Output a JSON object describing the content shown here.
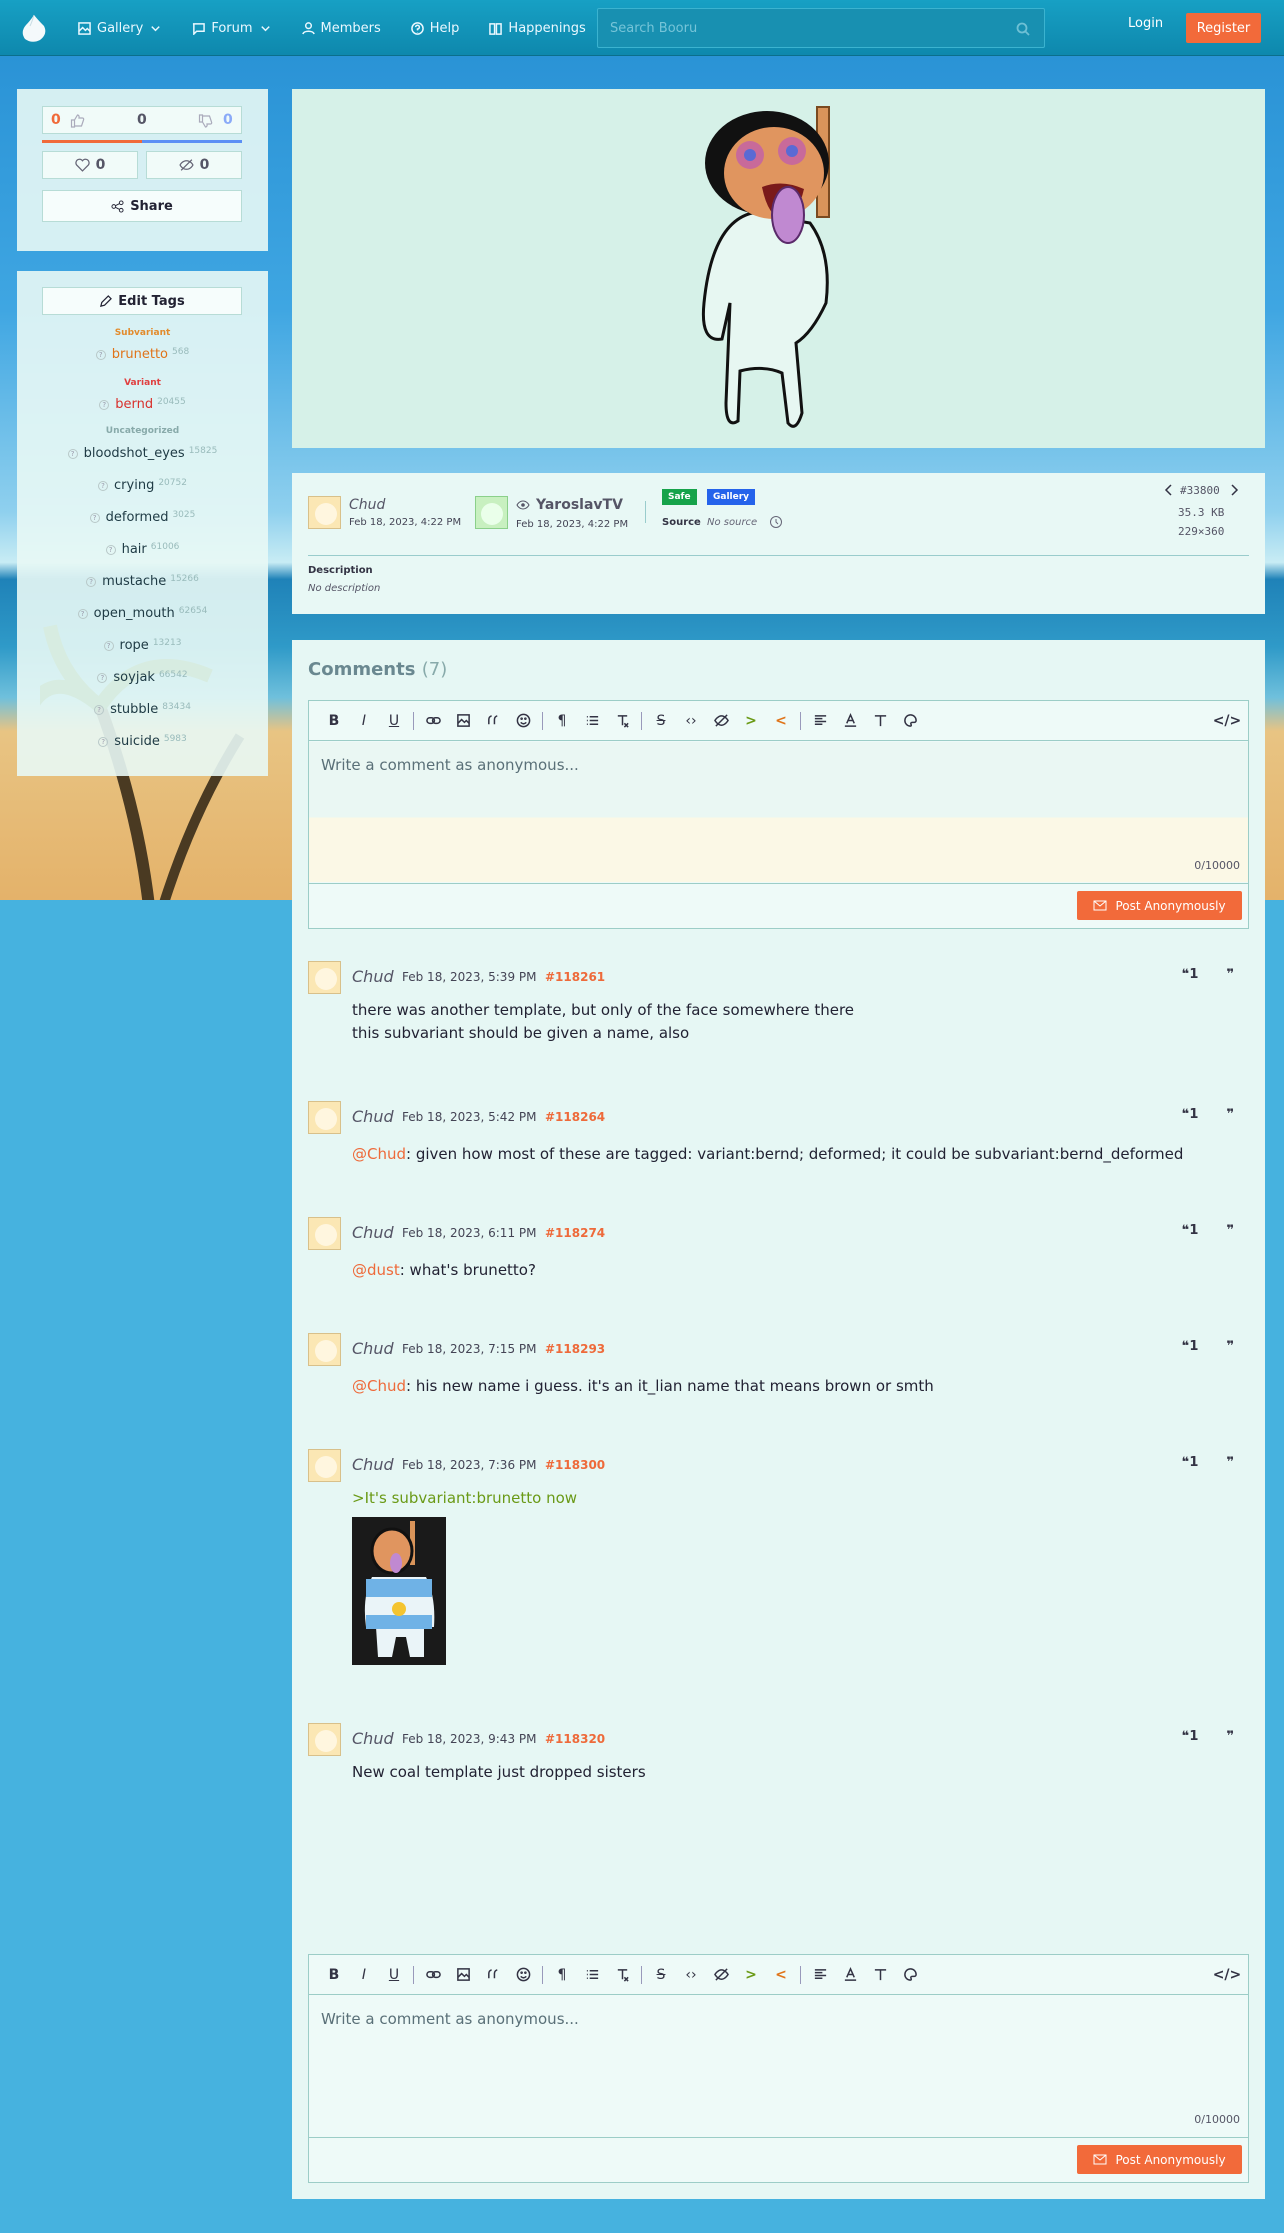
{
  "nav": {
    "items": [
      {
        "label": "Gallery",
        "icon": "image-icon",
        "dropdown": true
      },
      {
        "label": "Forum",
        "icon": "chat-icon",
        "dropdown": true
      },
      {
        "label": "Members",
        "icon": "user-icon"
      },
      {
        "label": "Help",
        "icon": "help-icon"
      },
      {
        "label": "Happenings",
        "icon": "book-icon"
      }
    ],
    "search_placeholder": "Search Booru",
    "login": "Login",
    "register": "Register"
  },
  "votes": {
    "up": "0",
    "score": "0",
    "down": "0",
    "favorites": "0",
    "hidden": "0",
    "share": "Share"
  },
  "tags": {
    "edit": "Edit Tags",
    "groups": [
      {
        "category": "Subvariant",
        "color": "#e28b2c",
        "items": [
          {
            "name": "brunetto",
            "count": "568",
            "color": "#e0741a"
          }
        ]
      },
      {
        "category": "Variant",
        "color": "#e04040",
        "items": [
          {
            "name": "bernd",
            "count": "20455",
            "color": "#d8302c"
          }
        ]
      },
      {
        "category": "Uncategorized",
        "color": "#8aa",
        "items": [
          {
            "name": "bloodshot_eyes",
            "count": "15825"
          },
          {
            "name": "crying",
            "count": "20752"
          },
          {
            "name": "deformed",
            "count": "3025"
          },
          {
            "name": "hair",
            "count": "61006"
          },
          {
            "name": "mustache",
            "count": "15266"
          },
          {
            "name": "open_mouth",
            "count": "62654"
          },
          {
            "name": "rope",
            "count": "13213"
          },
          {
            "name": "soyjak",
            "count": "66542"
          },
          {
            "name": "stubble",
            "count": "83434"
          },
          {
            "name": "suicide",
            "count": "5983"
          }
        ]
      }
    ]
  },
  "post": {
    "uploader": "Chud",
    "uploaded": "Feb 18, 2023, 4:22 PM",
    "approver": "YaroslavTV",
    "approved": "Feb 18, 2023, 4:22 PM",
    "rating": "Safe",
    "category": "Gallery",
    "source_label": "Source",
    "source": "No source",
    "id": "#33800",
    "size": "35.3 KB",
    "dimensions": "229×360",
    "desc_label": "Description",
    "description": "No description"
  },
  "comments": {
    "title": "Comments",
    "count": "(7)",
    "placeholder": "Write a comment as anonymous...",
    "counter": "0/10000",
    "post_label": "Post Anonymously",
    "quote_label": "1",
    "items": [
      {
        "author": "Chud",
        "date": "Feb 18, 2023, 5:39 PM",
        "id": "#118261",
        "lines": [
          "there was another template, but only of the face somewhere there",
          "this subvariant should be given a name, also"
        ]
      },
      {
        "author": "Chud",
        "date": "Feb 18, 2023, 5:42 PM",
        "id": "#118264",
        "mention": "@Chud",
        "text": ": given how most of these are tagged: variant:bernd; deformed; it could be subvariant:bernd_deformed"
      },
      {
        "author": "Chud",
        "date": "Feb 18, 2023, 6:11 PM",
        "id": "#118274",
        "mention": "@dust",
        "text": ": what's brunetto?"
      },
      {
        "author": "Chud",
        "date": "Feb 18, 2023, 7:15 PM",
        "id": "#118293",
        "mention": "@Chud",
        "text": ": his new name i guess. it's an it_lian name that means brown or smth"
      },
      {
        "author": "Chud",
        "date": "Feb 18, 2023, 7:36 PM",
        "id": "#118300",
        "greentext": ">It's subvariant:brunetto now"
      },
      {
        "author": "Chud",
        "date": "Feb 18, 2023, 9:43 PM",
        "id": "#118320",
        "text": "New coal template just dropped sisters"
      }
    ]
  }
}
